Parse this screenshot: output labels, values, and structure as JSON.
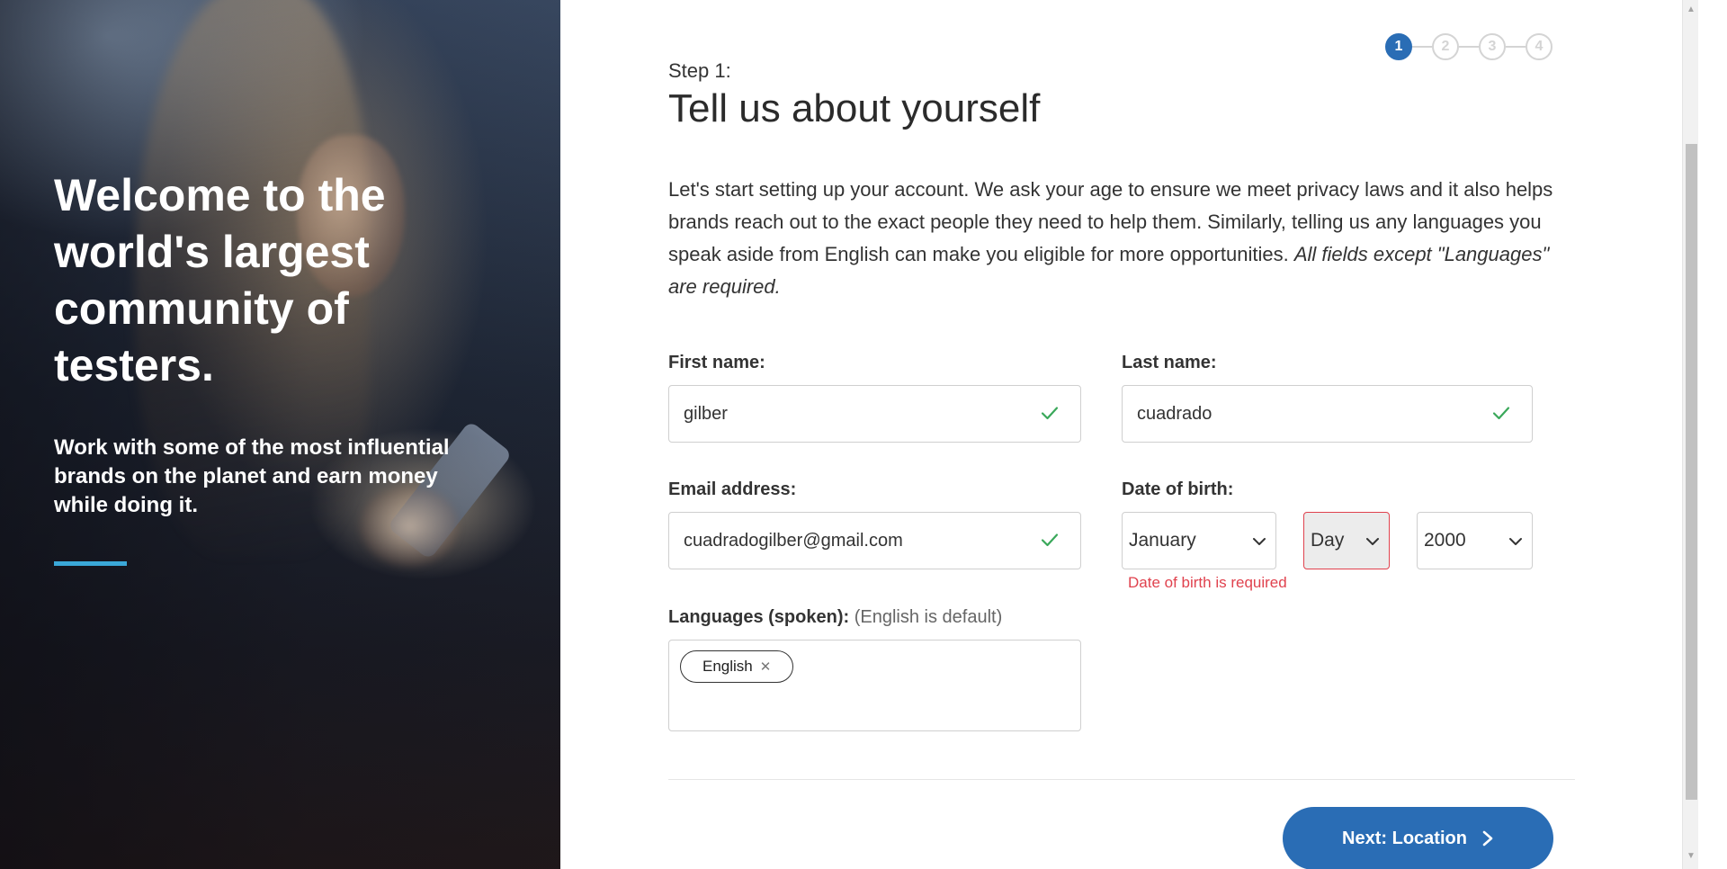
{
  "hero": {
    "title": "Welcome to the world's largest community of testers.",
    "subtitle": "Work with some of the most influential brands on the planet and earn money while doing it.",
    "accent_color": "#3aa8d8"
  },
  "stepper": {
    "steps": [
      "1",
      "2",
      "3",
      "4"
    ],
    "active_step": 1,
    "active_color": "#2a6db5"
  },
  "header": {
    "step_label": "Step 1:",
    "title": "Tell us about yourself"
  },
  "intro": {
    "text": "Let's start setting up your account. We ask your age to ensure we meet privacy laws and it also helps brands reach out to the exact people they need to help them. Similarly, telling us any languages you speak aside from English can make you eligible for more opportunities. ",
    "italic_text": "All fields except \"Languages\" are required."
  },
  "form": {
    "first_name": {
      "label": "First name:",
      "value": "gilber"
    },
    "last_name": {
      "label": "Last name:",
      "value": "cuadrado"
    },
    "email": {
      "label": "Email address:",
      "value": "cuadradogilber@gmail.com"
    },
    "dob": {
      "label": "Date of birth:",
      "month": "January",
      "day": "Day",
      "year": "2000",
      "error": "Date of birth is required"
    },
    "languages": {
      "label": "Languages (spoken):",
      "note": "(English is default)",
      "chips": [
        "English"
      ]
    }
  },
  "actions": {
    "next_label": "Next: Location"
  },
  "colors": {
    "primary": "#2a6db5",
    "valid": "#3aa85a",
    "error": "#e0424e"
  }
}
